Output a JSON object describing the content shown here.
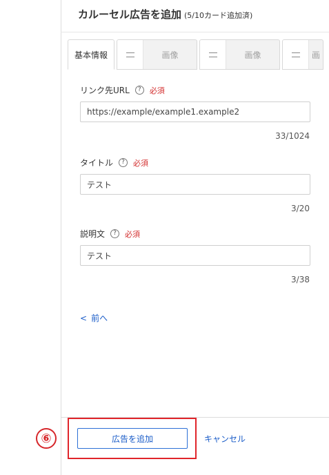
{
  "header": {
    "title": "カルーセル広告を追加",
    "sub": "(5/10カード追加済)"
  },
  "tabs": {
    "basic": "基本情報",
    "image1": "画像",
    "image2": "画像",
    "image3": "画"
  },
  "fields": {
    "url": {
      "label": "リンク先URL",
      "help": "?",
      "required": "必須",
      "value": "https://example/example1.example2",
      "counter": "33/1024"
    },
    "title": {
      "label": "タイトル",
      "help": "?",
      "required": "必須",
      "value": "テスト",
      "counter": "3/20"
    },
    "description": {
      "label": "説明文",
      "help": "?",
      "required": "必須",
      "value": "テスト",
      "counter": "3/38"
    }
  },
  "nav": {
    "prev_chevron": "<",
    "prev_label": "前へ"
  },
  "footer": {
    "step": "⑥",
    "add_button": "広告を追加",
    "cancel": "キャンセル"
  },
  "colors": {
    "accent": "#1a5cc8",
    "required": "#d32f2f",
    "highlight": "#e0242a"
  }
}
